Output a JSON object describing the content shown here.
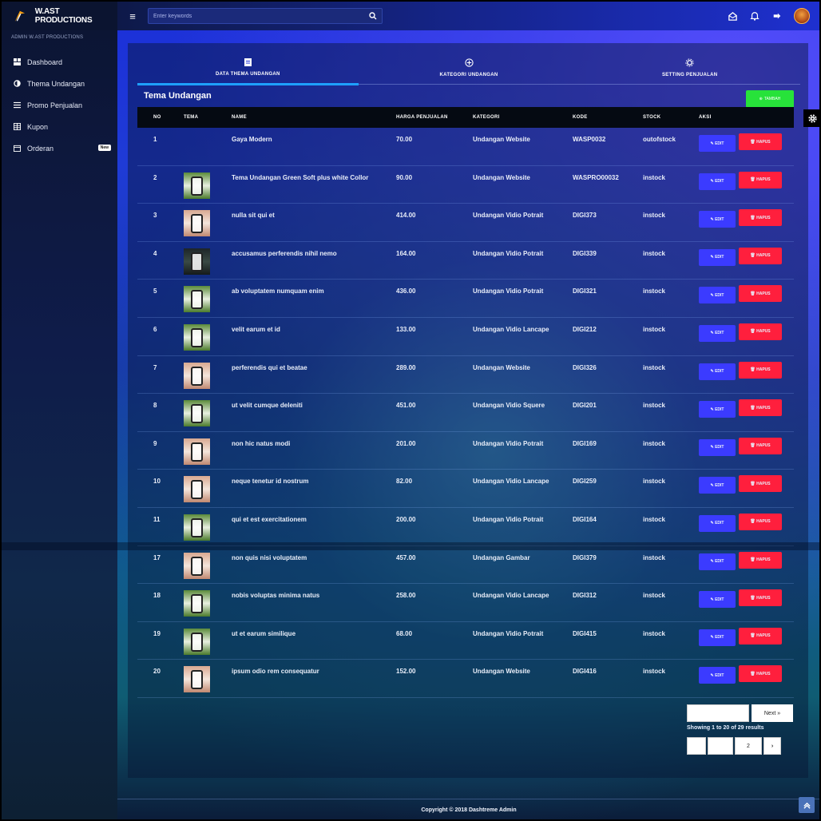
{
  "brand": {
    "name": "W.AST PRODUCTIONS"
  },
  "search": {
    "placeholder": "Enter keywords"
  },
  "sidebar": {
    "heading": "ADMIN W.AST PRODUCTIONS",
    "items": [
      {
        "label": "Dashboard",
        "icon": "dashboard-icon"
      },
      {
        "label": "Thema Undangan",
        "icon": "half-circle-icon"
      },
      {
        "label": "Promo Penjualan",
        "icon": "list-icon"
      },
      {
        "label": "Kupon",
        "icon": "table-icon"
      },
      {
        "label": "Orderan",
        "icon": "calendar-icon",
        "badge": "New"
      }
    ]
  },
  "tabs": [
    {
      "label": "DATA THEMA UNDANGAN",
      "icon": "file-icon",
      "active": true
    },
    {
      "label": "KATEGORI UNDANGAN",
      "icon": "plus-circle-icon",
      "active": false
    },
    {
      "label": "SETTING PENJUALAN",
      "icon": "settings-icon",
      "active": false
    }
  ],
  "section_title": "Tema Undangan",
  "add_button": "TAMBAH",
  "table": {
    "headers": [
      "NO",
      "TEMA",
      "NAME",
      "HARGA PENJUALAN",
      "KATEGORI",
      "KODE",
      "STOCK",
      "AKSI"
    ],
    "edit_label": "EDIT",
    "delete_label": "HAPUS",
    "rows": [
      {
        "no": "1",
        "name": "Gaya Modern",
        "price": "70.00",
        "category": "Undangan Website",
        "code": "WASP0032",
        "stock": "outofstock",
        "thumb": "none"
      },
      {
        "no": "2",
        "name": "Tema Undangan Green Soft plus white Collor",
        "price": "90.00",
        "category": "Undangan Website",
        "code": "WASPRO00032",
        "stock": "instock",
        "thumb": "green"
      },
      {
        "no": "3",
        "name": "nulla sit qui et",
        "price": "414.00",
        "category": "Undangan Vidio Potrait",
        "code": "DIGI373",
        "stock": "instock",
        "thumb": "peach"
      },
      {
        "no": "4",
        "name": "accusamus perferendis nihil nemo",
        "price": "164.00",
        "category": "Undangan Vidio Potrait",
        "code": "DIGI339",
        "stock": "instock",
        "thumb": "dark"
      },
      {
        "no": "5",
        "name": "ab voluptatem numquam enim",
        "price": "436.00",
        "category": "Undangan Vidio Potrait",
        "code": "DIGI321",
        "stock": "instock",
        "thumb": "green"
      },
      {
        "no": "6",
        "name": "velit earum et id",
        "price": "133.00",
        "category": "Undangan Vidio Lancape",
        "code": "DIGI212",
        "stock": "instock",
        "thumb": "green"
      },
      {
        "no": "7",
        "name": "perferendis qui et beatae",
        "price": "289.00",
        "category": "Undangan Website",
        "code": "DIGI326",
        "stock": "instock",
        "thumb": "peach"
      },
      {
        "no": "8",
        "name": "ut velit cumque deleniti",
        "price": "451.00",
        "category": "Undangan Vidio Squere",
        "code": "DIGI201",
        "stock": "instock",
        "thumb": "green"
      },
      {
        "no": "9",
        "name": "non hic natus modi",
        "price": "201.00",
        "category": "Undangan Vidio Potrait",
        "code": "DIGI169",
        "stock": "instock",
        "thumb": "peach"
      },
      {
        "no": "10",
        "name": "neque tenetur id nostrum",
        "price": "82.00",
        "category": "Undangan Vidio Lancape",
        "code": "DIGI259",
        "stock": "instock",
        "thumb": "peach"
      },
      {
        "no": "11",
        "name": "qui et est exercitationem",
        "price": "200.00",
        "category": "Undangan Vidio Potrait",
        "code": "DIGI164",
        "stock": "instock",
        "thumb": "green"
      },
      {
        "no": "17",
        "name": "non quis nisi voluptatem",
        "price": "457.00",
        "category": "Undangan Gambar",
        "code": "DIGI379",
        "stock": "instock",
        "thumb": "peach"
      },
      {
        "no": "18",
        "name": "nobis voluptas minima natus",
        "price": "258.00",
        "category": "Undangan Vidio Lancape",
        "code": "DIGI312",
        "stock": "instock",
        "thumb": "green"
      },
      {
        "no": "19",
        "name": "ut et earum similique",
        "price": "68.00",
        "category": "Undangan Vidio Potrait",
        "code": "DIGI415",
        "stock": "instock",
        "thumb": "green"
      },
      {
        "no": "20",
        "name": "ipsum odio rem consequatur",
        "price": "152.00",
        "category": "Undangan Website",
        "code": "DIGI416",
        "stock": "instock",
        "thumb": "peach"
      }
    ]
  },
  "pagination": {
    "next_label": "Next »",
    "info": "Showing 1 to 20 of 29 results",
    "page": "2",
    "next_arrow": "›"
  },
  "footer": {
    "copyright": "Copyright © 2018 Dashtreme Admin"
  },
  "colors": {
    "edit": "#3b3bff",
    "delete": "#ff1f3d",
    "add": "#27e23a",
    "active_tab": "#1ea0ff"
  }
}
